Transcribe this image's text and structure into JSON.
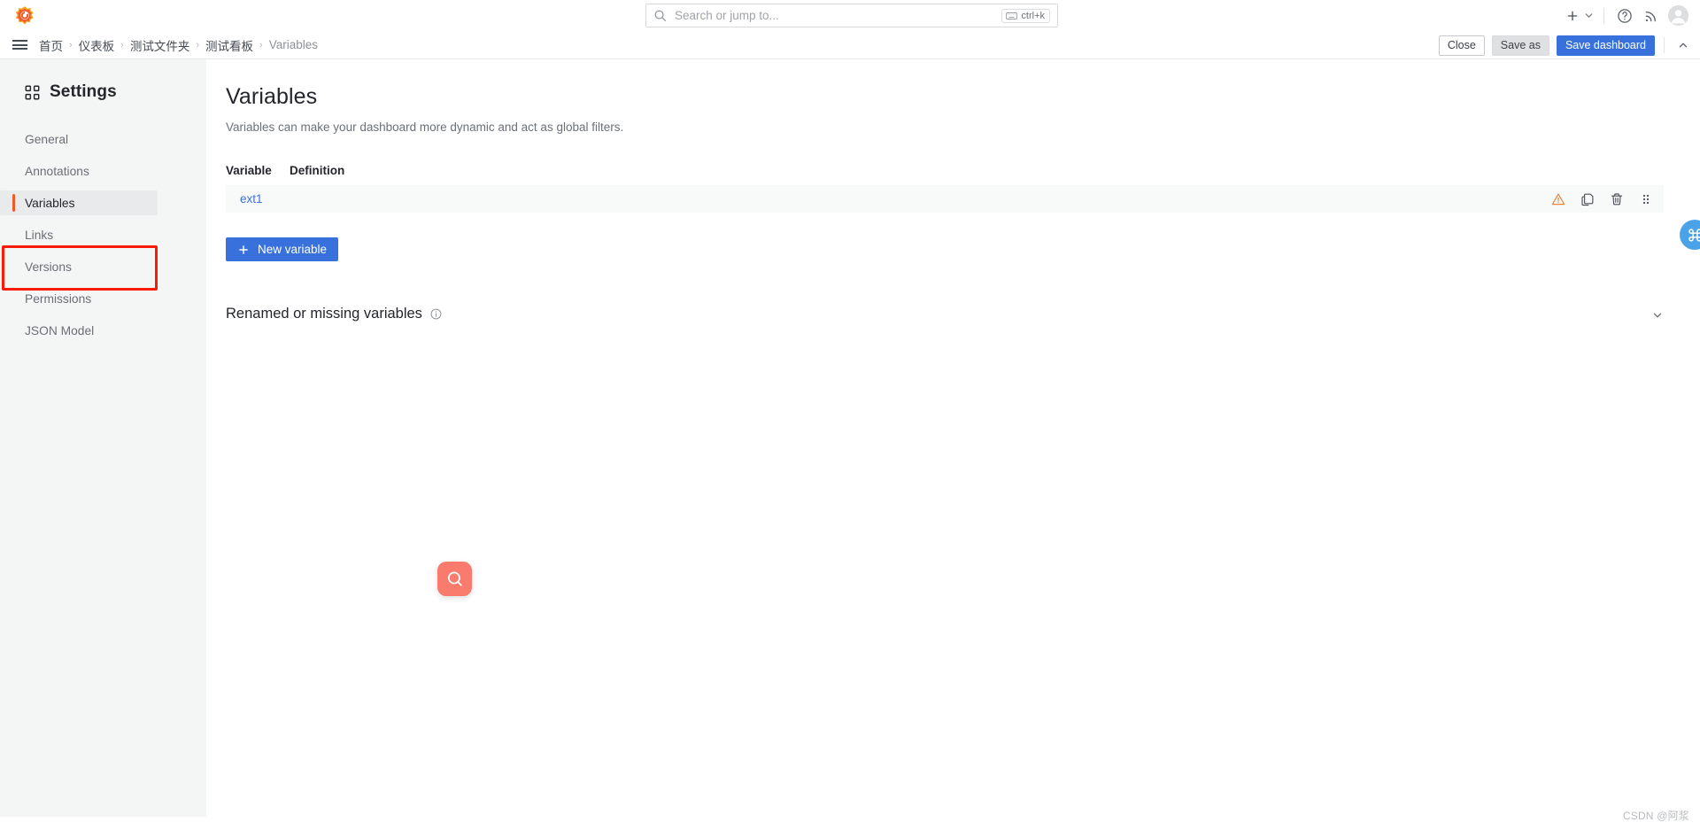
{
  "topbar": {
    "logo_icon": "grafana-logo-icon",
    "search": {
      "placeholder": "Search or jump to...",
      "icon": "search-icon",
      "shortcut": "ctrl+k",
      "shortcut_icon": "keyboard-icon"
    },
    "actions": {
      "add_icon": "plus-icon",
      "add_chevron_icon": "chevron-down-icon",
      "help_icon": "help-circle-icon",
      "news_icon": "rss-feed-icon",
      "avatar_icon": "user-avatar"
    }
  },
  "navbar": {
    "menu_icon": "hamburger-menu-icon",
    "breadcrumb": [
      "首页",
      "仪表板",
      "测试文件夹",
      "测试看板",
      "Variables"
    ],
    "separator": "›",
    "buttons": {
      "close": "Close",
      "save_as": "Save as",
      "save_dashboard": "Save dashboard",
      "collapse_icon": "chevron-up-icon"
    }
  },
  "sidebar": {
    "title": "Settings",
    "title_icon": "apps-grid-icon",
    "items": [
      {
        "label": "General",
        "active": false
      },
      {
        "label": "Annotations",
        "active": false
      },
      {
        "label": "Variables",
        "active": true
      },
      {
        "label": "Links",
        "active": false
      },
      {
        "label": "Versions",
        "active": false
      },
      {
        "label": "Permissions",
        "active": false
      },
      {
        "label": "JSON Model",
        "active": false
      }
    ],
    "highlight_color": "#fa1c08",
    "active_accent_color": "#f05a28"
  },
  "main": {
    "title": "Variables",
    "description": "Variables can make your dashboard more dynamic and act as global filters.",
    "table": {
      "columns": [
        "Variable",
        "Definition"
      ],
      "rows": [
        {
          "variable": "ext1",
          "definition": "",
          "actions": [
            "warning-triangle-icon",
            "duplicate-icon",
            "trash-icon",
            "drag-handle-icon"
          ]
        }
      ]
    },
    "new_variable_button": {
      "label": "New variable",
      "icon": "plus-icon"
    },
    "renamed_section": {
      "title": "Renamed or missing variables",
      "info_icon": "info-circle-icon",
      "expand_icon": "chevron-down-icon"
    }
  },
  "floating": {
    "search_widget_icon": "search-circle-icon",
    "search_widget_color": "#f97b6e",
    "command_widget_icon": "command-keyboard-icon",
    "command_widget_color": "#4aa3e8"
  },
  "watermark": "CSDN @阿浆"
}
